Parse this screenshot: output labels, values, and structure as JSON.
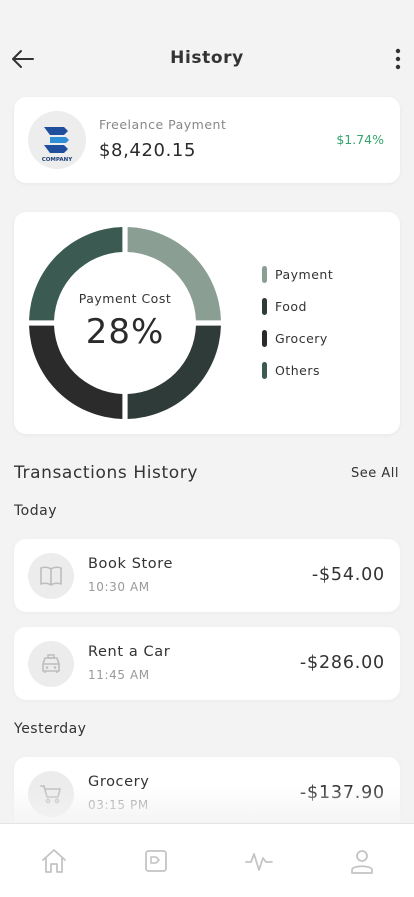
{
  "header": {
    "title": "History",
    "back_icon": "arrow-left-icon",
    "more_icon": "more-vertical-icon"
  },
  "payment_card": {
    "logo_text": "COMPANY",
    "label": "Freelance Payment",
    "amount": "$8,420.15",
    "change": "$1.74%",
    "change_color": "#35a66c"
  },
  "chart_data": {
    "type": "pie",
    "center_label": "Payment Cost",
    "center_value": "28%",
    "slices": [
      {
        "label": "Payment",
        "value": 25,
        "color": "#8a9e93"
      },
      {
        "label": "Food",
        "value": 25,
        "color": "#2f3b38"
      },
      {
        "label": "Grocery",
        "value": 25,
        "color": "#2b2b2b"
      },
      {
        "label": "Others",
        "value": 25,
        "color": "#3b5a51"
      }
    ],
    "legend_position": "right"
  },
  "transactions": {
    "title": "Transactions History",
    "see_all": "See All",
    "groups": [
      {
        "label": "Today",
        "items": [
          {
            "name": "Book Store",
            "time": "10:30 AM",
            "amount": "-$54.00",
            "icon": "book-icon"
          },
          {
            "name": "Rent a Car",
            "time": "11:45 AM",
            "amount": "-$286.00",
            "icon": "car-icon"
          }
        ]
      },
      {
        "label": "Yesterday",
        "items": [
          {
            "name": "Grocery",
            "time": "03:15 PM",
            "amount": "-$137.90",
            "icon": "cart-icon"
          }
        ]
      }
    ]
  },
  "tabbar": {
    "items": [
      {
        "icon": "home-icon"
      },
      {
        "icon": "wallet-icon"
      },
      {
        "icon": "activity-icon"
      },
      {
        "icon": "user-icon"
      }
    ]
  }
}
